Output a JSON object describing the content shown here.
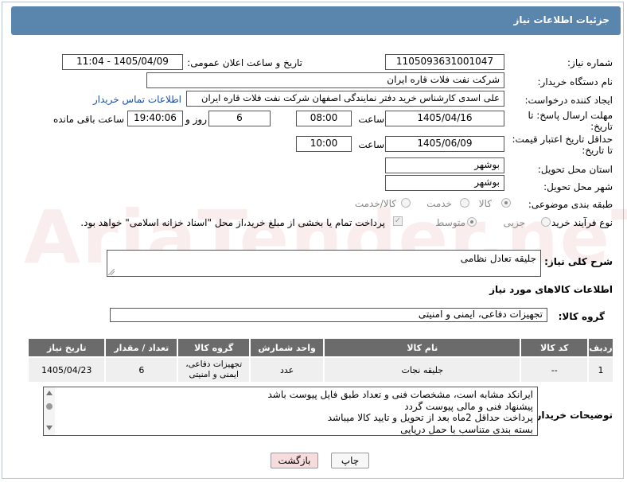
{
  "header": {
    "title": "جزئیات اطلاعات نیاز"
  },
  "need_number": {
    "label": "شماره نیاز:",
    "value": "1105093631001047"
  },
  "announce": {
    "label": "تاریخ و ساعت اعلان عمومی:",
    "value": "1405/04/09 - 11:04"
  },
  "buyer_org": {
    "label": "نام دستگاه خریدار:",
    "value": "شرکت نفت فلات قاره ایران"
  },
  "creator": {
    "label": "ایجاد کننده درخواست:",
    "value": "علی اسدی کارشناس خرید دفتر نمایندگی اصفهان شرکت نفت فلات قاره ایران",
    "contact_link": "اطلاعات تماس خریدار"
  },
  "reply_deadline": {
    "label_line1": "مهلت ارسال پاسخ: تا",
    "label_line2": "تاریخ:",
    "date": "1405/04/16",
    "time_label": "ساعت",
    "time": "08:00",
    "days": "6",
    "days_label": "روز و",
    "remaining": "19:40:06",
    "remaining_label": "ساعت باقی مانده"
  },
  "price_validity": {
    "label_line1": "حداقل تاریخ اعتبار قیمت:",
    "label_line2": "تا تاریخ:",
    "date": "1405/06/09",
    "time_label": "ساعت",
    "time": "10:00"
  },
  "province": {
    "label": "استان محل تحویل:",
    "value": "بوشهر"
  },
  "city": {
    "label": "شهر محل تحویل:",
    "value": "بوشهر"
  },
  "category": {
    "label": "طبقه بندی موضوعی:",
    "options": [
      "کالا",
      "خدمت",
      "کالا/خدمت"
    ],
    "selected": "کالا"
  },
  "process": {
    "label": "نوع فرآیند خرید :",
    "options": [
      "جزیی",
      "متوسط"
    ],
    "selected": "متوسط",
    "payment_note": "پرداخت تمام یا بخشی از مبلغ خرید،از محل \"اسناد خزانه اسلامی\" خواهد بود."
  },
  "description": {
    "label": "شرح کلی نیاز:",
    "value": "جلیقه تعادل نظامی"
  },
  "goods_info": {
    "title": "اطلاعات کالاهای مورد نیاز"
  },
  "goods_group": {
    "label": "گروه کالا:",
    "value": "تجهیزات دفاعی، ایمنی و امنیتی"
  },
  "table": {
    "columns": [
      "ردیف",
      "کد کالا",
      "نام کالا",
      "واحد شمارش",
      "گروه کالا",
      "تعداد / مقدار",
      "تاریخ نیاز"
    ],
    "rows": [
      [
        "1",
        "--",
        "جلیقه نجات",
        "عدد",
        "تجهیزات دفاعی، ایمنی و امنیتی",
        "6",
        "1405/04/23"
      ]
    ]
  },
  "buyer_notes": {
    "label": "توضیحات خریدار:",
    "lines": [
      "ایرانکد مشابه است، مشخصات فنی و تعداد طبق فایل پیوست باشد",
      "پیشنهاد فنی و مالی پیوست گردد",
      "پرداخت حداقل 2ماه بعد از تحویل و تایید کالا میباشد",
      "بسته بندی متناسب با حمل دریایی"
    ]
  },
  "buttons": {
    "print": "چاپ",
    "back": "بازگشت"
  },
  "watermark": "AriaTender.neT",
  "colors": {
    "header": "#5a86ad",
    "table_header": "#6b6b6b",
    "back_button": "#f6dcdc"
  }
}
